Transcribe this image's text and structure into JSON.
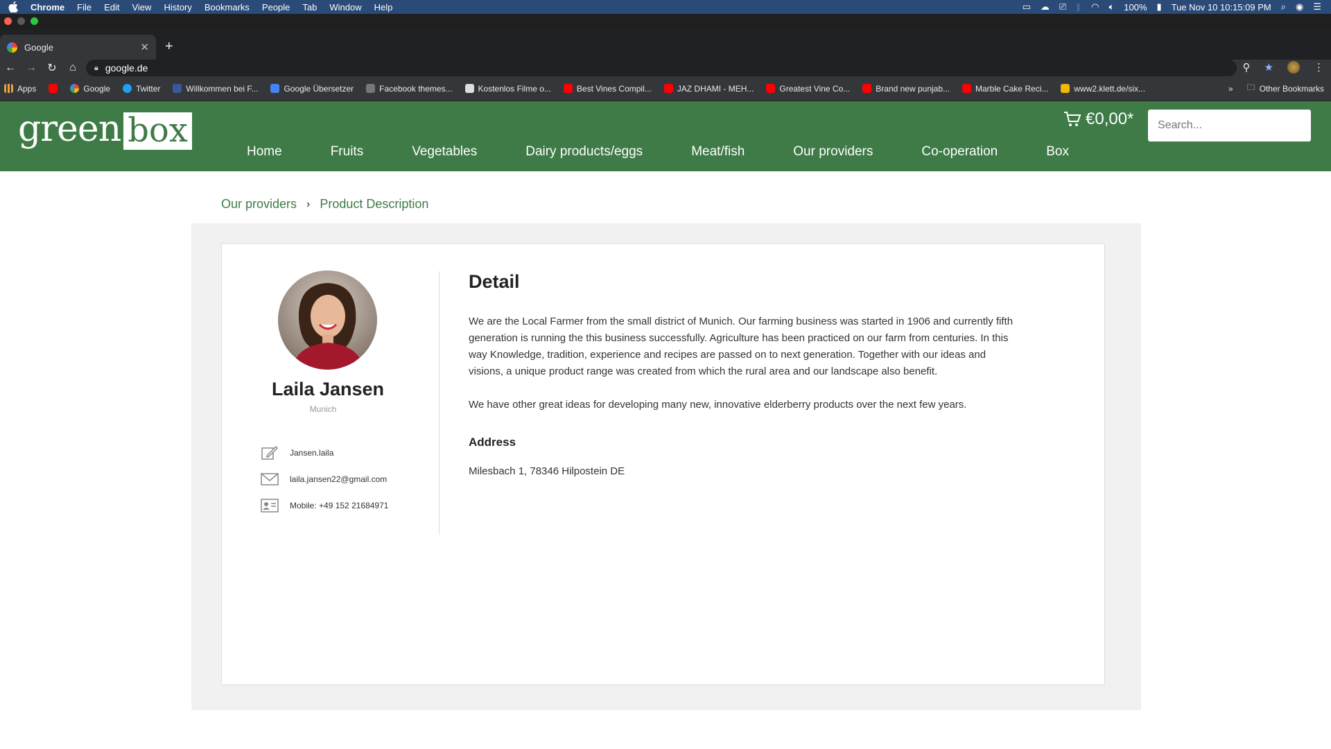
{
  "menubar": {
    "app": "Chrome",
    "items": [
      "File",
      "Edit",
      "View",
      "History",
      "Bookmarks",
      "People",
      "Tab",
      "Window",
      "Help"
    ],
    "battery": "100%",
    "clock": "Tue Nov 10  10:15:09 PM"
  },
  "browser": {
    "tab_title": "Google",
    "url": "google.de",
    "bookmarks": [
      {
        "label": "Apps",
        "color": "#e8a33d"
      },
      {
        "label": "Google",
        "color": "#4285f4"
      },
      {
        "label": "Twitter",
        "color": "#1da1f2"
      },
      {
        "label": "Willkommen bei F...",
        "color": "#3b5998"
      },
      {
        "label": "Google Übersetzer",
        "color": "#4285f4"
      },
      {
        "label": "Facebook themes...",
        "color": "#777777"
      },
      {
        "label": "Kostenlos Filme o...",
        "color": "#dddddd"
      },
      {
        "label": "Best Vines Compil...",
        "color": "#ff0000"
      },
      {
        "label": "JAZ DHAMI - MEH...",
        "color": "#ff0000"
      },
      {
        "label": "Greatest Vine Co...",
        "color": "#ff0000"
      },
      {
        "label": "Brand new punjab...",
        "color": "#ff0000"
      },
      {
        "label": "Marble Cake Reci...",
        "color": "#ff0000"
      },
      {
        "label": "www2.klett.de/six...",
        "color": "#f2b705"
      }
    ],
    "other_bookmarks": "Other Bookmarks"
  },
  "site": {
    "logo_a": "green",
    "logo_b": "box",
    "nav": [
      "Home",
      "Fruits",
      "Vegetables",
      "Dairy products/eggs",
      "Meat/fish",
      "Our providers",
      "Co-operation",
      "Box"
    ],
    "cart_price": "€0,00*",
    "search_placeholder": "Search...",
    "accent": "#3e7b47"
  },
  "breadcrumb": {
    "parent": "Our providers",
    "current": "Product Description"
  },
  "profile": {
    "name": "Laila Jansen",
    "city": "Munich",
    "username": "Jansen.laila",
    "email": "laila.jansen22@gmail.com",
    "mobile": "Mobile: +49 152 21684971"
  },
  "detail": {
    "title": "Detail",
    "para1": "We are the Local Farmer from the small district of Munich. Our farming business was started in 1906 and currently fifth generation is running the this business successfully. Agriculture has been practiced on our farm from centuries. In this way Knowledge, tradition, experience and recipes are passed on to next generation. Together with our ideas and visions, a unique product range was created from which the rural area and our landscape also benefit.",
    "para2": "We have other great ideas for developing many new, innovative elderberry products over the next few years.",
    "address_title": "Address",
    "address": "Milesbach 1, 78346 Hilpostein DE"
  }
}
